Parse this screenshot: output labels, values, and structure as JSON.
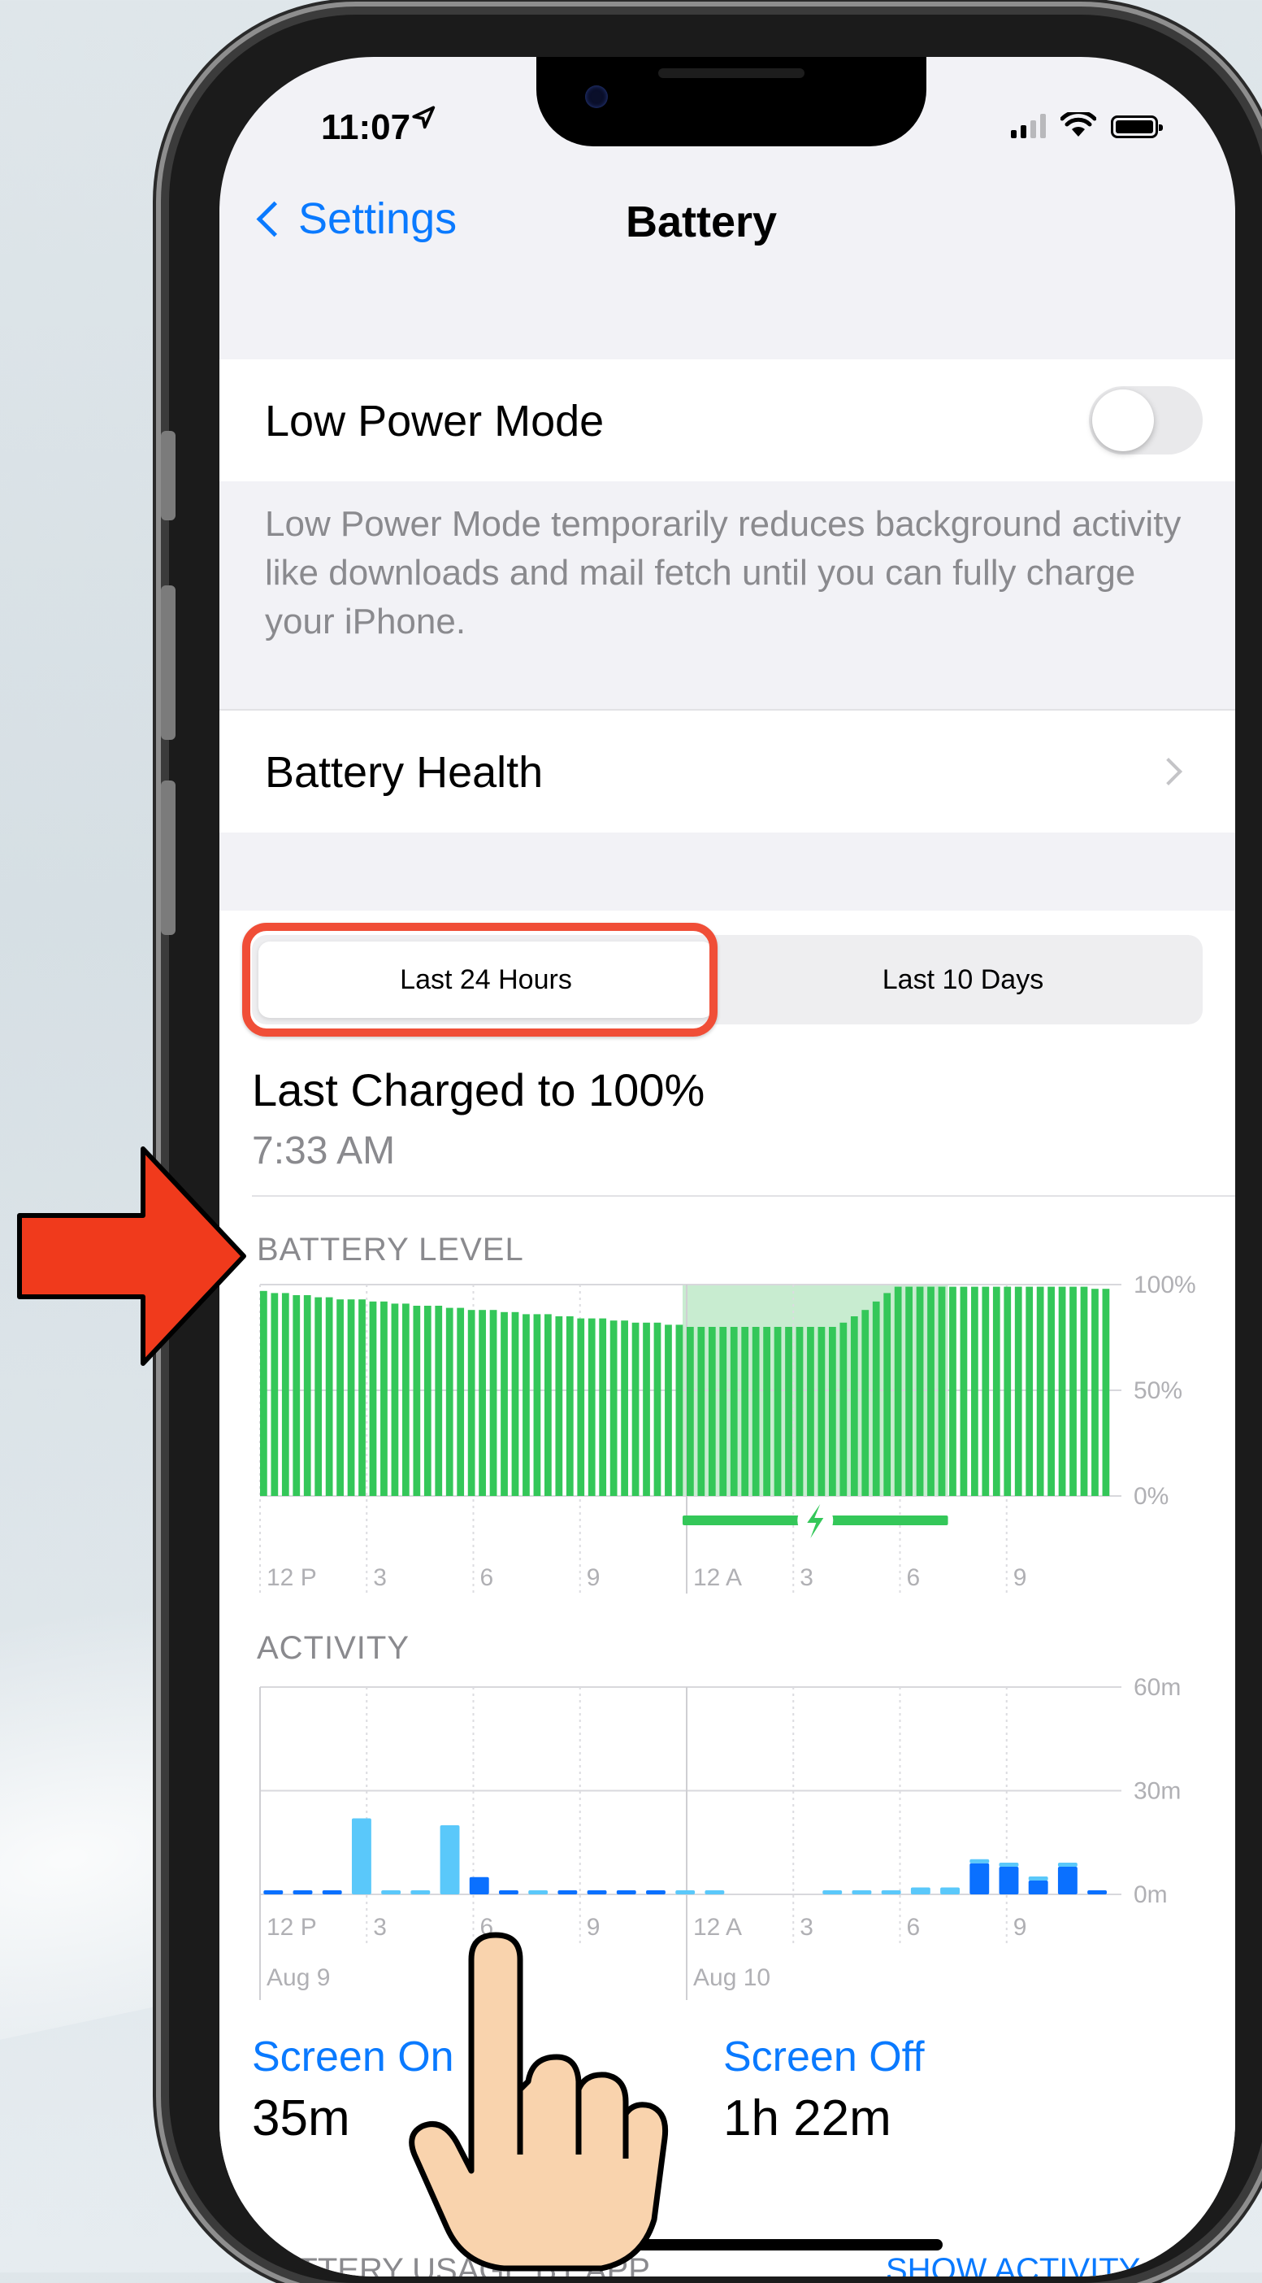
{
  "status_bar": {
    "time": "11:07"
  },
  "nav": {
    "back_label": "Settings",
    "title": "Battery"
  },
  "low_power": {
    "label": "Low Power Mode",
    "enabled": false,
    "description": "Low Power Mode temporarily reduces background activity like downloads and mail fetch until you can fully charge your iPhone."
  },
  "battery_health": {
    "label": "Battery Health"
  },
  "segment": {
    "options": [
      "Last 24 Hours",
      "Last 10 Days"
    ],
    "selected": "Last 24 Hours"
  },
  "last_charged": {
    "title": "Last Charged to 100%",
    "time": "7:33 AM"
  },
  "battery_level": {
    "heading": "BATTERY LEVEL"
  },
  "activity": {
    "heading": "ACTIVITY"
  },
  "usage": {
    "screen_on_label": "Screen On",
    "screen_on_value": "35m",
    "screen_off_label": "Screen Off",
    "screen_off_value": "1h 22m"
  },
  "footer": {
    "left": "BATTERY USAGE BY APP",
    "right": "SHOW ACTIVITY"
  },
  "colors": {
    "accent": "#0a7aff",
    "battery_green": "#34c759",
    "charge_band": "#c8ecd0",
    "activity_dark": "#0a70ff",
    "activity_light": "#5ac8fa",
    "annotation_red": "#f04e37"
  },
  "chart_data": [
    {
      "type": "bar",
      "title": "BATTERY LEVEL",
      "x_tick_labels": [
        "12 P",
        "3",
        "6",
        "9",
        "12 A",
        "3",
        "6",
        "9"
      ],
      "y_tick_labels": [
        "100%",
        "50%",
        "0%"
      ],
      "ylim": [
        0,
        100
      ],
      "values": [
        97,
        96,
        96,
        95,
        95,
        94,
        94,
        93,
        93,
        93,
        92,
        92,
        91,
        91,
        90,
        90,
        90,
        89,
        89,
        88,
        88,
        88,
        87,
        87,
        86,
        86,
        86,
        85,
        85,
        84,
        84,
        84,
        83,
        83,
        82,
        82,
        82,
        81,
        81,
        80,
        80,
        80,
        80,
        80,
        80,
        80,
        80,
        80,
        80,
        80,
        80,
        80,
        80,
        82,
        85,
        88,
        92,
        96,
        99,
        99,
        99,
        99,
        99,
        99,
        99,
        99,
        99,
        99,
        99,
        99,
        99,
        99,
        99,
        99,
        99,
        99,
        98,
        98
      ],
      "charging": {
        "start_label": "12 A",
        "end_label": "6"
      }
    },
    {
      "type": "bar",
      "title": "ACTIVITY",
      "x_tick_labels": [
        "12 P",
        "3",
        "6",
        "9",
        "12 A",
        "3",
        "6",
        "9"
      ],
      "x_date_labels": [
        "Aug 9",
        "Aug 10"
      ],
      "y_tick_labels": [
        "60m",
        "30m",
        "0m"
      ],
      "ylim": [
        0,
        60
      ],
      "series": [
        {
          "color": "dark",
          "values": [
            1,
            1,
            1,
            0,
            0,
            0,
            0,
            5,
            1,
            0,
            1,
            1,
            1,
            1,
            0,
            0,
            0,
            0,
            0,
            0,
            0,
            0,
            0,
            0,
            9,
            8,
            4,
            8,
            1
          ]
        },
        {
          "color": "light",
          "values": [
            0,
            0,
            0,
            22,
            1,
            1,
            20,
            0,
            0,
            1,
            0,
            0,
            0,
            0,
            1,
            1,
            0,
            0,
            0,
            1,
            1,
            1,
            2,
            2,
            1,
            1,
            1,
            1,
            0
          ]
        }
      ]
    }
  ]
}
